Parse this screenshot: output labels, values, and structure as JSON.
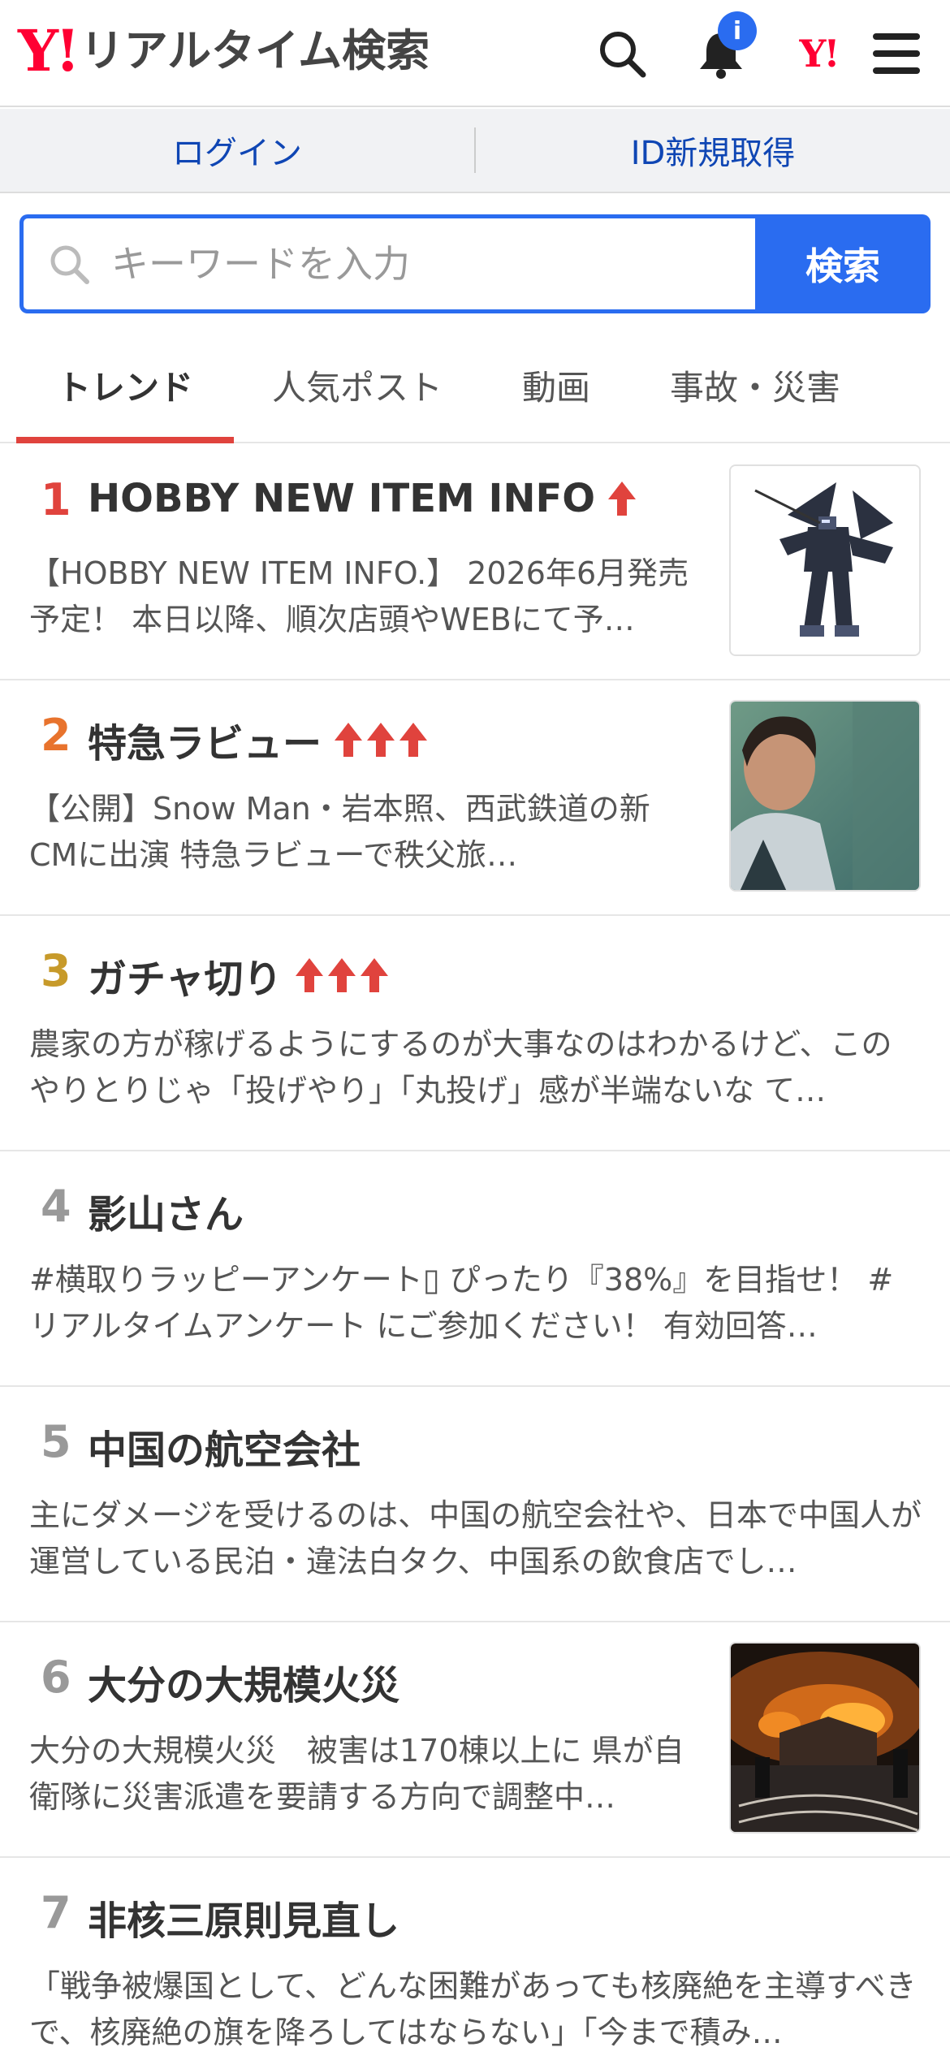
{
  "header": {
    "logo_mark": "Y!",
    "logo_text": "リアルタイム検索",
    "notification_count": "i",
    "yahoo_small": "Y!"
  },
  "loginbar": {
    "login": "ログイン",
    "register": "ID新規取得"
  },
  "search": {
    "placeholder": "キーワードを入力",
    "button": "検索"
  },
  "tabs": [
    {
      "label": "トレンド",
      "active": true
    },
    {
      "label": "人気ポスト",
      "active": false
    },
    {
      "label": "動画",
      "active": false
    },
    {
      "label": "事故・災害",
      "active": false
    }
  ],
  "colors": {
    "accent_blue": "#2a6cf0",
    "rank1": "#e0433d",
    "rank2": "#e8732d",
    "rank3": "#c79a2a",
    "rank_other": "#999999",
    "arrow_red": "#e0433d"
  },
  "trends": [
    {
      "rank": "1",
      "title": "HOBBY NEW ITEM INFO",
      "arrows": 1,
      "desc": "【HOBBY NEW ITEM INFO.】 2026年6月発売予定！ 本日以降、順次店頭やWEBにて予…",
      "thumb": "robot-figure"
    },
    {
      "rank": "2",
      "title": "特急ラビュー",
      "arrows": 3,
      "desc": "【公開】Snow Man・岩本照、西武鉄道の新CMに出演 特急ラビューで秩父旅…",
      "thumb": "person-train"
    },
    {
      "rank": "3",
      "title": "ガチャ切り",
      "arrows": 3,
      "desc": "農家の方が稼げるようにするのが大事なのはわかるけど、このやりとりじゃ「投げやり」「丸投げ」感が半端ないな て…",
      "thumb": ""
    },
    {
      "rank": "4",
      "title": "影山さん",
      "arrows": 0,
      "desc": "#横取りラッピーアンケート▯ ぴったり『38%』を目指せ！ #リアルタイムアンケート にご参加ください！ 有効回答…",
      "thumb": ""
    },
    {
      "rank": "5",
      "title": "中国の航空会社",
      "arrows": 0,
      "desc": "主にダメージを受けるのは、中国の航空会社や、日本で中国人が運営している民泊・違法白タク、中国系の飲食店でし…",
      "thumb": ""
    },
    {
      "rank": "6",
      "title": "大分の大規模火災",
      "arrows": 0,
      "desc": "大分の大規模火災　被害は170棟以上に 県が自衛隊に災害派遣を要請する方向で調整中…",
      "thumb": "fire-scene"
    },
    {
      "rank": "7",
      "title": "非核三原則見直し",
      "arrows": 0,
      "desc": "「戦争被爆国として、どんな困難があっても核廃絶を主導すべきで、核廃絶の旗を降ろしてはならない」「今まで積み…",
      "thumb": ""
    }
  ]
}
